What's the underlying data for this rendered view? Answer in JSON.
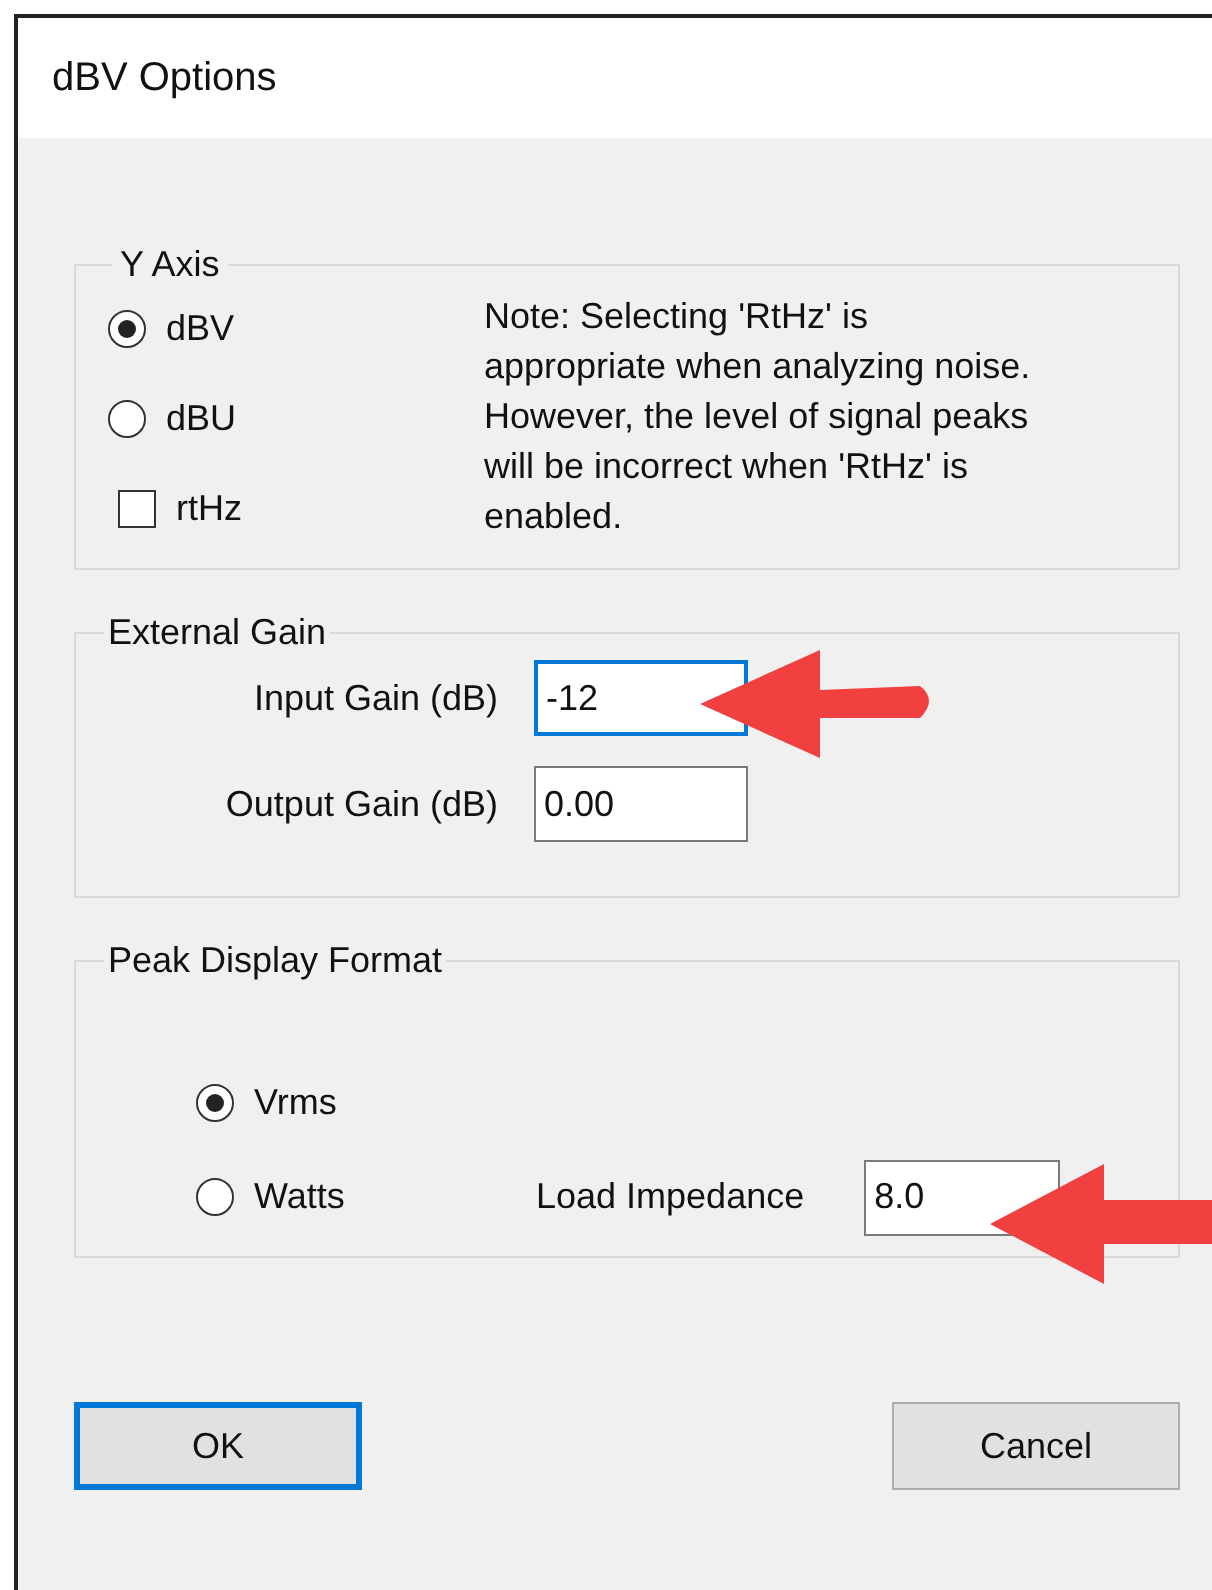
{
  "window": {
    "title": "dBV Options"
  },
  "y_axis": {
    "title": "Y Axis",
    "options": [
      {
        "kind": "radio",
        "label": "dBV",
        "selected": true
      },
      {
        "kind": "radio",
        "label": "dBU",
        "selected": false
      },
      {
        "kind": "checkbox",
        "label": "rtHz",
        "checked": false
      }
    ],
    "note": "Note: Selecting 'RtHz' is appropriate when analyzing noise. However, the level of signal peaks will be incorrect when 'RtHz' is enabled."
  },
  "external_gain": {
    "title": "External Gain",
    "fields": [
      {
        "label": "Input Gain (dB)",
        "value": "-12",
        "focused": true
      },
      {
        "label": "Output Gain (dB)",
        "value": "0.00",
        "focused": false
      }
    ]
  },
  "peak_display_format": {
    "title": "Peak Display Format",
    "options": [
      {
        "label": "Vrms",
        "selected": true
      },
      {
        "label": "Watts",
        "selected": false
      }
    ],
    "load_impedance": {
      "label": "Load Impedance",
      "value": "8.0"
    }
  },
  "buttons": [
    {
      "label": "OK",
      "default": true
    },
    {
      "label": "Cancel",
      "default": false
    }
  ]
}
